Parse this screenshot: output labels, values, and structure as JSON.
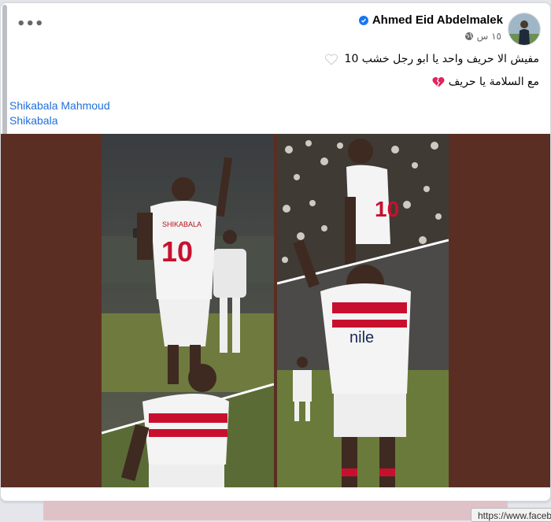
{
  "post": {
    "author": "Ahmed Eid Abdelmalek",
    "verified": true,
    "time": "١٥ س",
    "privacy_icon": "globe-icon",
    "more_icon": "more-options-icon",
    "text_line1": "مفيش الا حريف واحد يا ابو رجل خشب 10",
    "text_line2": "مع السلامة يا حريف",
    "emoji_line1": "white-heart",
    "emoji_line2": "broken-heart",
    "tags": [
      "Shikabala Mahmoud",
      "Shikabala"
    ],
    "photo_left_jersey": "10",
    "photo_left_name": "SHIKABALA",
    "photo_right_sponsor": "nile",
    "photo_right_jersey": "10"
  },
  "status_bar": {
    "url": "https://www.faceb"
  },
  "colors": {
    "link": "#216fdb",
    "media_background": "#5b2e24",
    "accent_verified": "#1877f2"
  }
}
